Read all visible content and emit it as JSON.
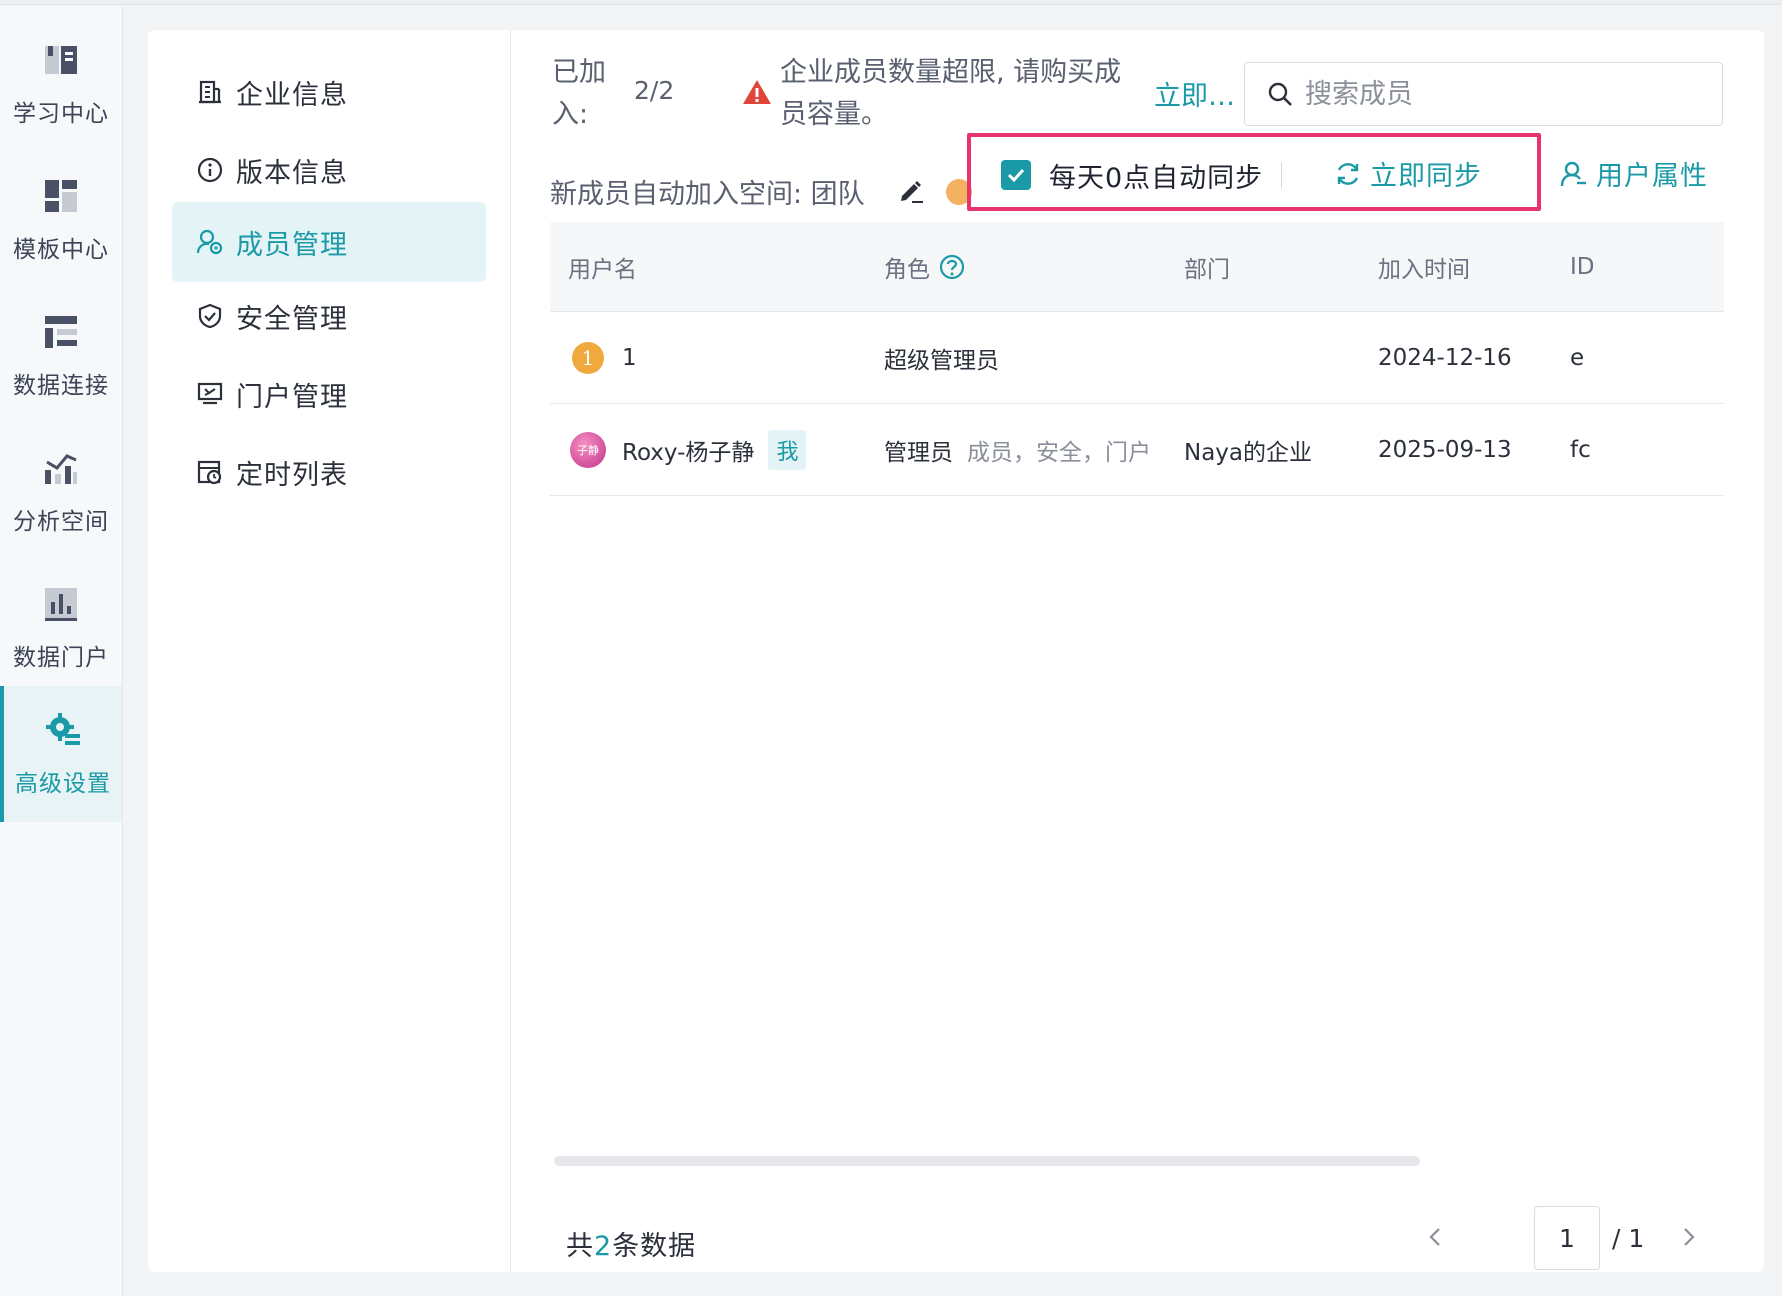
{
  "rail": {
    "items": [
      {
        "label": "学习中心",
        "icon": "book-icon"
      },
      {
        "label": "模板中心",
        "icon": "template-icon"
      },
      {
        "label": "数据连接",
        "icon": "data-connection-icon"
      },
      {
        "label": "分析空间",
        "icon": "analysis-icon"
      },
      {
        "label": "数据门户",
        "icon": "portal-chart-icon"
      },
      {
        "label": "高级设置",
        "icon": "advanced-settings-icon",
        "active": true
      }
    ]
  },
  "subnav": {
    "items": [
      {
        "label": "企业信息",
        "icon": "building-icon"
      },
      {
        "label": "版本信息",
        "icon": "info-icon"
      },
      {
        "label": "成员管理",
        "icon": "member-settings-icon",
        "active": true
      },
      {
        "label": "安全管理",
        "icon": "shield-icon"
      },
      {
        "label": "门户管理",
        "icon": "portal-icon"
      },
      {
        "label": "定时列表",
        "icon": "schedule-icon"
      }
    ]
  },
  "header": {
    "joined_label": "已加入:",
    "joined_count": "2/2",
    "warning_text": "企业成员数量超限, 请购买成员容量。",
    "buy_link": "立即…",
    "search_placeholder": "搜索成员",
    "auto_join_text": "新成员自动加入空间: 团队",
    "daily_sync_label": "每天0点自动同步",
    "daily_sync_checked": true,
    "sync_now_label": "立即同步",
    "user_attr_label": "用户属性"
  },
  "table": {
    "columns": [
      "用户名",
      "角色",
      "部门",
      "加入时间",
      "ID"
    ],
    "rows": [
      {
        "avatar": "1",
        "name": "1",
        "me": "",
        "role": "超级管理员",
        "role_extra": "",
        "dept": "",
        "joined": "2024-12-16",
        "id": "e"
      },
      {
        "avatar": "子静",
        "name": "Roxy-杨子静",
        "me": "我",
        "role": "管理员",
        "role_extra": "成员，安全，门户",
        "dept": "Naya的企业",
        "joined": "2025-09-13",
        "id": "fc"
      }
    ]
  },
  "footer": {
    "total_prefix": "共",
    "total_count": "2",
    "total_suffix": "条数据",
    "current_page": "1",
    "total_pages": "/ 1"
  },
  "colors": {
    "accent": "#1a9aa6",
    "highlight": "#e5346f",
    "warning": "#e0453a"
  }
}
